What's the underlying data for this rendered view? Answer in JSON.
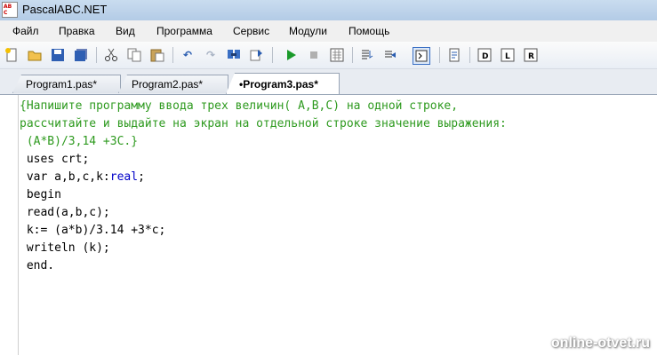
{
  "window": {
    "title": "PascalABC.NET"
  },
  "menu": [
    "Файл",
    "Правка",
    "Вид",
    "Программа",
    "Сервис",
    "Модули",
    "Помощь"
  ],
  "tabs": [
    {
      "label": "Program1.pas*",
      "active": false
    },
    {
      "label": "Program2.pas*",
      "active": false
    },
    {
      "label": "•Program3.pas*",
      "active": true
    }
  ],
  "code_lines": [
    "{Напишите программу ввода трех величин( A,B,C) на одной строке,",
    "рассчитайте и выдайте на экран на отдельной строке значение выражения:",
    " (A*B)/3,14 +3C.}",
    " uses crt;",
    " var a,b,c,k:",
    "real",
    ";",
    " begin",
    " read(a,b,c);",
    " k:= (a*b)/3.14 +3*c;",
    " writeln (k);",
    " end."
  ],
  "watermark": "online-otvet.ru"
}
